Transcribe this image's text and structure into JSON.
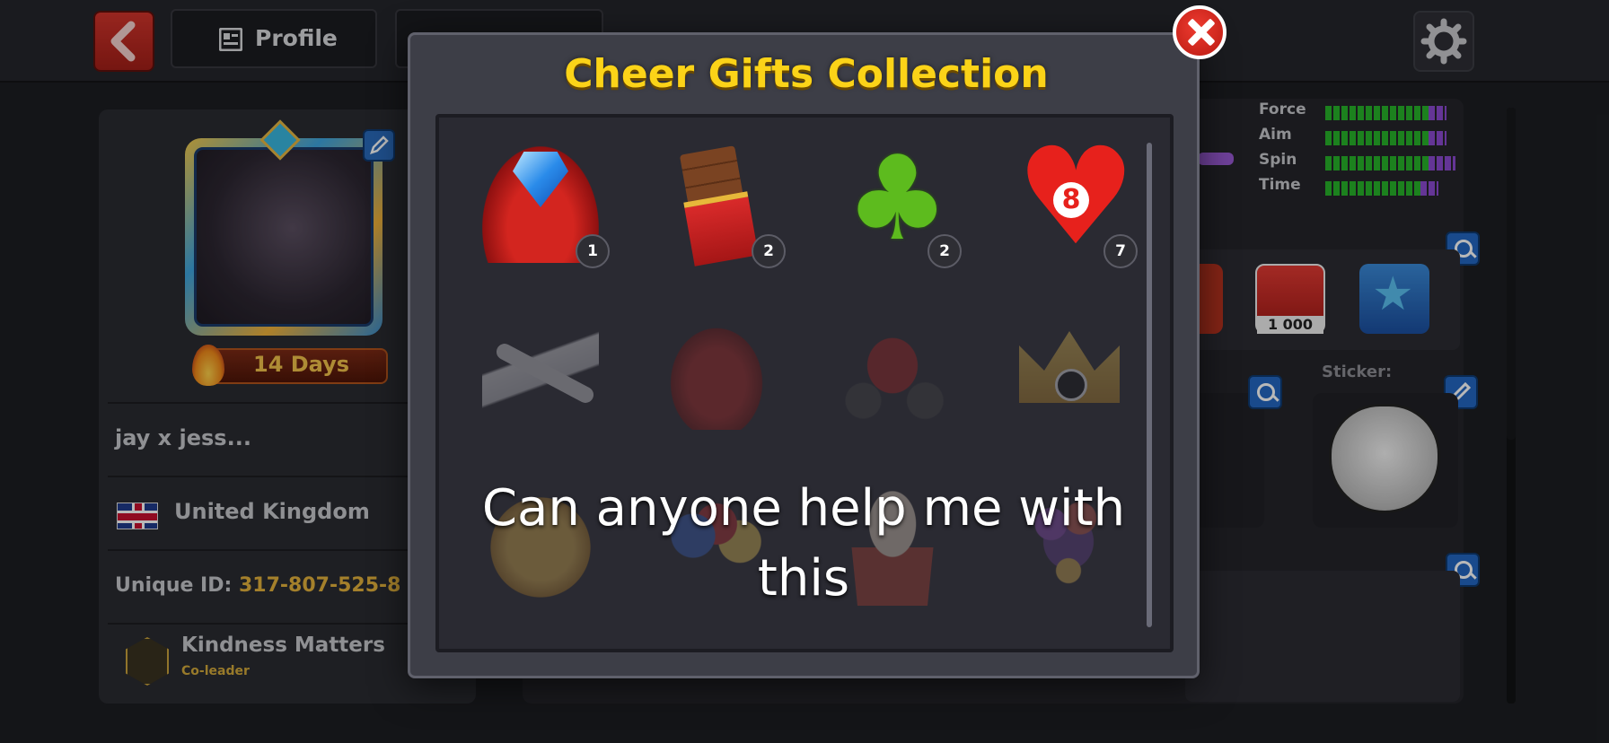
{
  "topbar": {
    "back_icon": "chevron-left-icon",
    "tabs": [
      {
        "label": "Profile",
        "icon": "profile-card-icon"
      },
      {
        "label": ""
      }
    ],
    "settings_icon": "gear-icon"
  },
  "profile": {
    "streak_label": "14 Days",
    "name": "jay x jess...",
    "country": "United Kingdom",
    "flag_icon": "uk-flag-icon",
    "unique_id_label": "Unique ID:",
    "unique_id_value": "317-807-525-8",
    "club_name": "Kindness Matters",
    "club_role": "Co-leader"
  },
  "stats": [
    {
      "label": "Force",
      "level": 0.86
    },
    {
      "label": "Aim",
      "level": 0.86
    },
    {
      "label": "Spin",
      "level": 0.93
    },
    {
      "label": "Time",
      "level": 0.79
    }
  ],
  "achievements": {
    "trophy_value": "1 000"
  },
  "sticker": {
    "label": "Sticker:",
    "icon": "troll-face-icon"
  },
  "modal": {
    "title": "Cheer Gifts Collection",
    "close_icon": "close-x-icon",
    "gifts": [
      {
        "name": "diamond-cushion-icon",
        "count": "1",
        "owned": true
      },
      {
        "name": "chocolate-bar-icon",
        "count": "2",
        "owned": true
      },
      {
        "name": "four-leaf-clover-icon",
        "count": "2",
        "owned": true
      },
      {
        "name": "heart-8-ball-icon",
        "count": "7",
        "owned": true
      },
      {
        "name": "private-jet-icon",
        "count": "",
        "owned": false
      },
      {
        "name": "sports-car-icon",
        "count": "",
        "owned": false
      },
      {
        "name": "motorcycle-icon",
        "count": "",
        "owned": false
      },
      {
        "name": "crown-8-ball-icon",
        "count": "",
        "owned": false
      },
      {
        "name": "8-ball-coin-icon",
        "count": "",
        "owned": false
      },
      {
        "name": "balloons-icon",
        "count": "",
        "owned": false
      },
      {
        "name": "cupcake-icon",
        "count": "",
        "owned": false
      },
      {
        "name": "flower-bouquet-icon",
        "count": "",
        "owned": false
      }
    ]
  },
  "caption": {
    "line1": "Can anyone help me with",
    "line2": "this"
  },
  "colors": {
    "title_yellow": "#fbd318",
    "id_gold": "#e3b23c",
    "close_red": "#d9271f",
    "accent_blue": "#2367c2"
  }
}
